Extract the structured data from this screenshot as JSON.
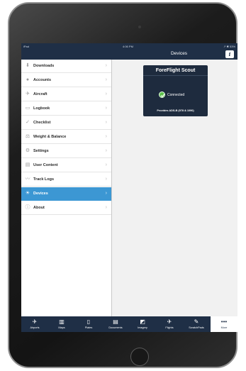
{
  "status_bar": {
    "carrier": "iPad",
    "time": "4:06 PM",
    "right": "↗ ✱ 53%"
  },
  "nav": {
    "title": "Devices",
    "info_label": "i"
  },
  "sidebar": {
    "items": [
      {
        "label": "Downloads",
        "icon": "download-icon",
        "glyph": "⬇",
        "selected": false
      },
      {
        "label": "Accounts",
        "icon": "person-icon",
        "glyph": "●",
        "selected": false
      },
      {
        "label": "Aircraft",
        "icon": "airplane-icon",
        "glyph": "✈",
        "selected": false
      },
      {
        "label": "Logbook",
        "icon": "logbook-icon",
        "glyph": "▭",
        "selected": false
      },
      {
        "label": "Checklist",
        "icon": "checklist-icon",
        "glyph": "✓",
        "selected": false
      },
      {
        "label": "Weight & Balance",
        "icon": "scale-icon",
        "glyph": "⚖",
        "selected": false
      },
      {
        "label": "Settings",
        "icon": "gear-icon",
        "glyph": "⚙",
        "selected": false
      },
      {
        "label": "User Content",
        "icon": "document-icon",
        "glyph": "▤",
        "selected": false
      },
      {
        "label": "Track Logs",
        "icon": "track-icon",
        "glyph": "〰",
        "selected": false
      },
      {
        "label": "Devices",
        "icon": "lightbulb-icon",
        "glyph": "☀",
        "selected": true
      },
      {
        "label": "About",
        "icon": "info-icon",
        "glyph": "ⓘ",
        "selected": false
      }
    ]
  },
  "device_card": {
    "title": "ForeFlight Scout",
    "status": "Connected",
    "description": "Provides ADS-B (978 & 1090)"
  },
  "tab_bar": {
    "tabs": [
      {
        "label": "Airports",
        "icon": "airport-icon",
        "glyph": "✈",
        "active": false
      },
      {
        "label": "Maps",
        "icon": "map-icon",
        "glyph": "▥",
        "active": false
      },
      {
        "label": "Plates",
        "icon": "plates-icon",
        "glyph": "▯",
        "active": false
      },
      {
        "label": "Documents",
        "icon": "documents-icon",
        "glyph": "▤",
        "active": false
      },
      {
        "label": "Imagery",
        "icon": "imagery-icon",
        "glyph": "◩",
        "active": false
      },
      {
        "label": "Flights",
        "icon": "flights-icon",
        "glyph": "✈",
        "active": false
      },
      {
        "label": "ScratchPads",
        "icon": "pencil-icon",
        "glyph": "✎",
        "active": false
      },
      {
        "label": "More",
        "icon": "more-icon",
        "glyph": "•••",
        "active": true
      }
    ]
  },
  "colors": {
    "nav_background": "#1f2f46",
    "selected_row": "#3c97d3",
    "card_background": "#1e2b3e",
    "connected_green": "#5cc04a"
  }
}
